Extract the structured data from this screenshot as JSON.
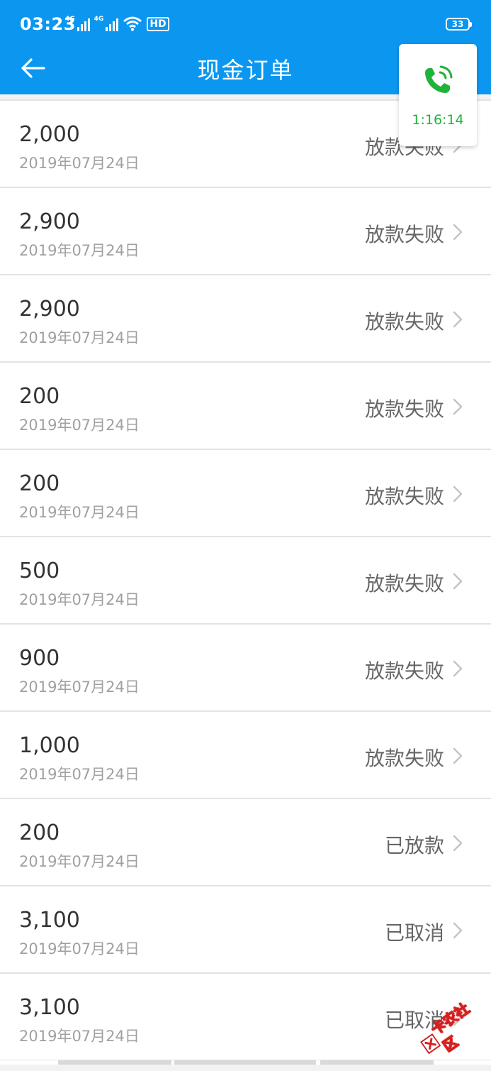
{
  "status_bar": {
    "time": "03:23",
    "signal1_label": "4G",
    "signal2_label": "4G",
    "hd_label": "HD",
    "battery": "33"
  },
  "header": {
    "title": "现金订单",
    "back_icon": "arrow-left-icon",
    "color": "#0b97f0"
  },
  "call_widget": {
    "timer": "1:16:14",
    "icon": "phone-call-icon",
    "color": "#20b339"
  },
  "orders": [
    {
      "amount": "2,000",
      "date": "2019年07月24日",
      "status": "放款失败"
    },
    {
      "amount": "2,900",
      "date": "2019年07月24日",
      "status": "放款失败"
    },
    {
      "amount": "2,900",
      "date": "2019年07月24日",
      "status": "放款失败"
    },
    {
      "amount": "200",
      "date": "2019年07月24日",
      "status": "放款失败"
    },
    {
      "amount": "200",
      "date": "2019年07月24日",
      "status": "放款失败"
    },
    {
      "amount": "500",
      "date": "2019年07月24日",
      "status": "放款失败"
    },
    {
      "amount": "900",
      "date": "2019年07月24日",
      "status": "放款失败"
    },
    {
      "amount": "1,000",
      "date": "2019年07月24日",
      "status": "放款失败"
    },
    {
      "amount": "200",
      "date": "2019年07月24日",
      "status": "已放款"
    },
    {
      "amount": "3,100",
      "date": "2019年07月24日",
      "status": "已取消"
    },
    {
      "amount": "3,100",
      "date": "2019年07月24日",
      "status": "已取消"
    }
  ],
  "watermark": {
    "text": "卡农社区"
  }
}
